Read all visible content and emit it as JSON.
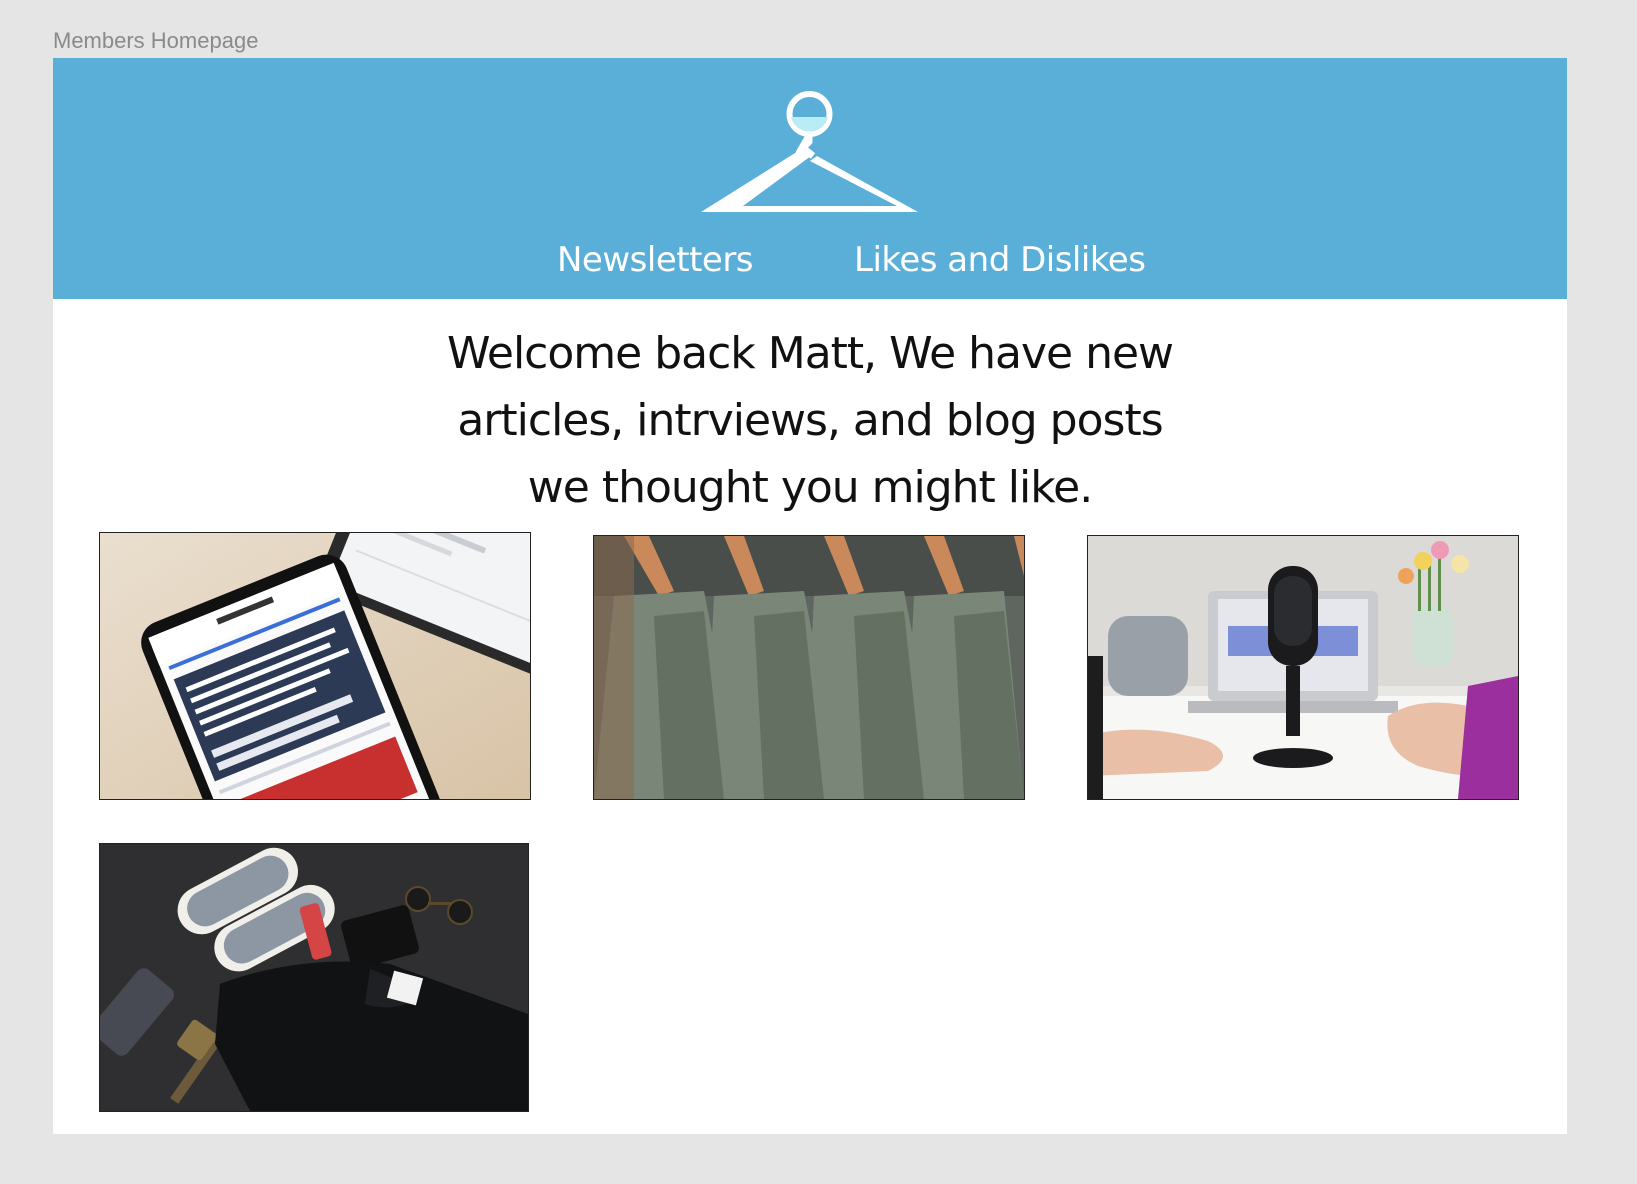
{
  "canvas": {
    "frame_label": "Members Homepage"
  },
  "colors": {
    "header_bg": "#5aafd9",
    "page_bg": "#ffffff",
    "canvas_bg": "#e5e5e5",
    "text_dark": "#111111",
    "text_light": "#ffffff"
  },
  "header": {
    "logo_icon": "clothes-hanger-icon",
    "nav": [
      {
        "label": "Newsletters"
      },
      {
        "label": "Likes and  Dislikes"
      }
    ]
  },
  "welcome": {
    "lines": [
      "Welcome back  Matt, We have new",
      "articles, intrviews, and blog posts",
      "we thought you might like."
    ]
  },
  "cards": [
    {
      "image": "smartphone-news-app-photo"
    },
    {
      "image": "green-shirts-on-hangers-photo"
    },
    {
      "image": "podcast-microphone-photo"
    },
    {
      "image": "sneakers-flat-lay-photo"
    }
  ]
}
